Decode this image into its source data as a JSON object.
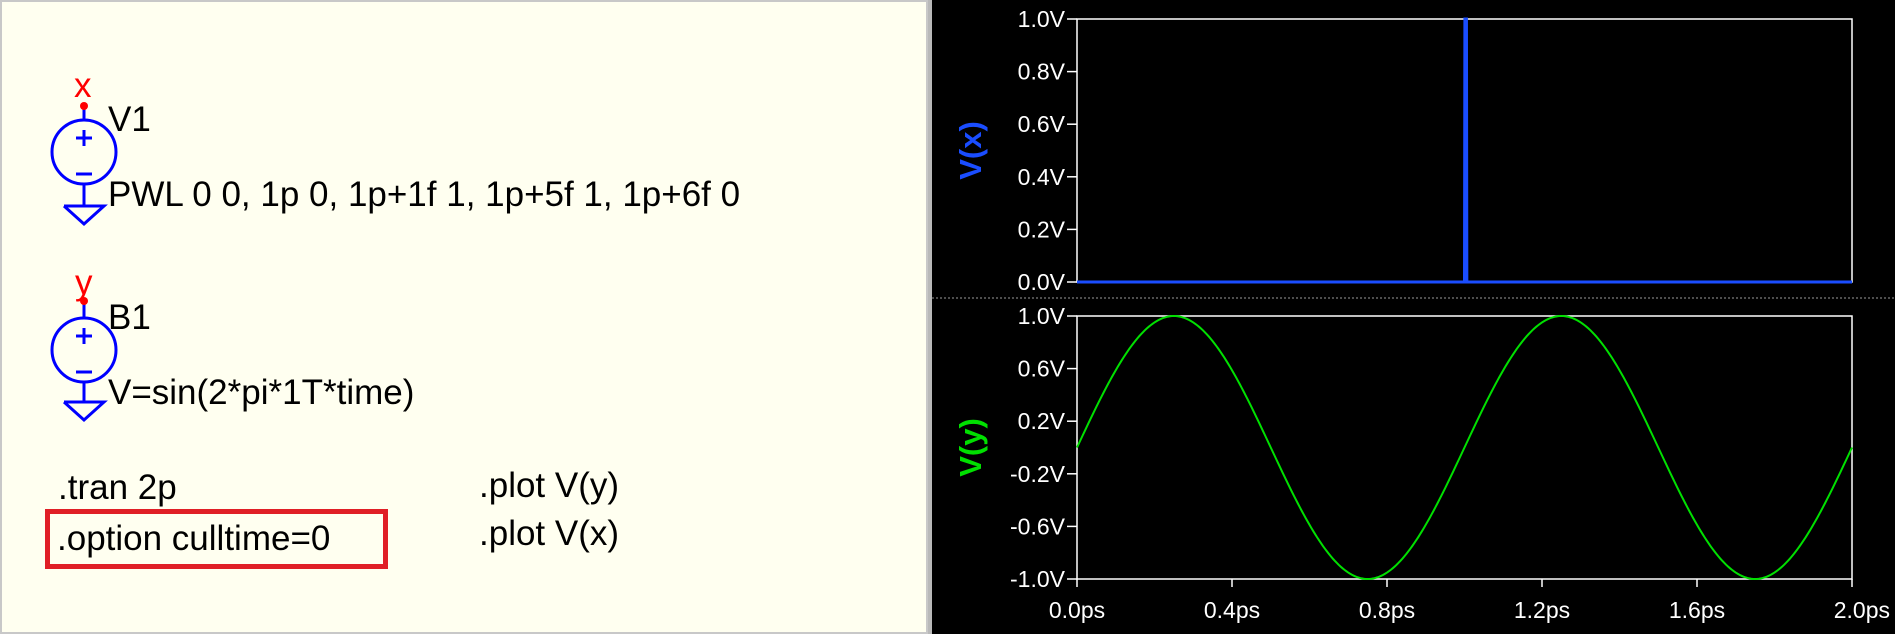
{
  "schematic": {
    "net_labels": {
      "v1_net": "x",
      "b1_net": "y"
    },
    "components": [
      {
        "name": "V1",
        "value": "PWL 0 0, 1p 0, 1p+1f 1, 1p+5f 1, 1p+6f 0"
      },
      {
        "name": "B1",
        "value": "V=sin(2*pi*1T*time)"
      }
    ],
    "directives": {
      "tran": ".tran 2p",
      "option": ".option culltime=0",
      "plot_y": ".plot V(y)",
      "plot_x": ".plot V(x)"
    },
    "colors": {
      "wire": "#0000ff",
      "net_label": "#ff0000",
      "highlight": "#e01f26",
      "background": "#fffff0"
    }
  },
  "waveform": {
    "background": "#000000",
    "x_ticks": [
      "0.0ps",
      "0.4ps",
      "0.8ps",
      "1.2ps",
      "1.6ps",
      "2.0ps"
    ],
    "panes": [
      {
        "trace_label": "V(x)",
        "color": "#1a4dff",
        "y_ticks": [
          "1.0V",
          "0.8V",
          "0.6V",
          "0.4V",
          "0.2V",
          "0.0V"
        ]
      },
      {
        "trace_label": "V(y)",
        "color": "#00e000",
        "y_ticks": [
          "1.0V",
          "0.6V",
          "0.2V",
          "-0.2V",
          "-0.6V",
          "-1.0V"
        ]
      }
    ]
  },
  "chart_data": [
    {
      "type": "line",
      "series": [
        {
          "name": "V(x)",
          "x": [
            0,
            1.0,
            1.001,
            1.005,
            1.006,
            2.0
          ],
          "y": [
            0,
            0,
            1,
            1,
            0,
            0
          ]
        }
      ],
      "x_unit": "ps",
      "ylabel": "V(x)",
      "xlim": [
        0,
        2.0
      ],
      "ylim": [
        0,
        1.0
      ]
    },
    {
      "type": "line",
      "series": [
        {
          "name": "V(y)",
          "function": "sin(2*pi*1T*time)",
          "frequency_THz": 1,
          "amplitude_V": 1
        }
      ],
      "x_unit": "ps",
      "ylabel": "V(y)",
      "xlim": [
        0,
        2.0
      ],
      "ylim": [
        -1.0,
        1.0
      ]
    }
  ]
}
